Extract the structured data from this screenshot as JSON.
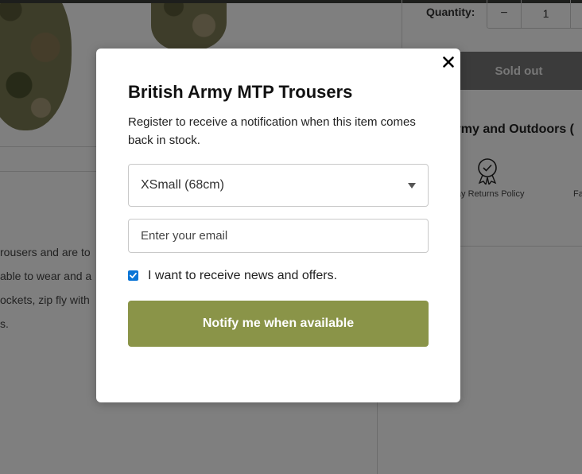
{
  "background": {
    "quantity_label": "Quantity:",
    "quantity_minus": "−",
    "quantity_value": "1",
    "sold_out_label": "Sold out",
    "store_heading": "Army and Outdoors (",
    "returns_text": "Day Returns Policy",
    "fa_text": "Fa",
    "description_lines": [
      "rousers and are to",
      "able to wear and a",
      "ockets, zip fly with",
      "s."
    ],
    "icons": {
      "badge": "award-badge-icon"
    }
  },
  "modal": {
    "title": "British Army MTP Trousers",
    "subtitle": "Register to receive a notification when this item comes back in stock.",
    "size_select": {
      "selected": "XSmall (68cm)",
      "caret_icon": "chevron-down-icon"
    },
    "email_placeholder": "Enter your email",
    "newsletter_checkbox": {
      "checked": true,
      "label": "I want to receive news and offers."
    },
    "notify_button_label": "Notify me when available",
    "close_icon": "close-icon",
    "colors": {
      "button": "#8a9448",
      "checkbox": "#0b75d6"
    }
  }
}
